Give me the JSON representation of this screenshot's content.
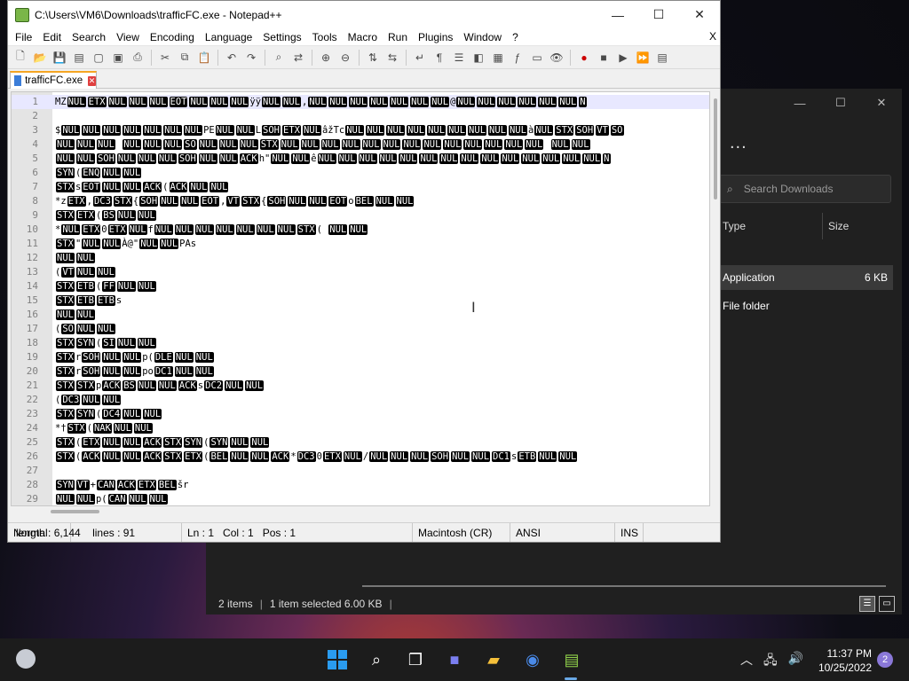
{
  "explorer": {
    "more_label": "...",
    "search_placeholder": "Search Downloads",
    "columns": {
      "type": "Type",
      "size": "Size"
    },
    "rows": [
      {
        "type": "Application",
        "size": "6 KB"
      },
      {
        "type": "File folder",
        "size": ""
      }
    ],
    "status": {
      "items": "2 items",
      "selected": "1 item selected  6.00 KB"
    }
  },
  "npp": {
    "title": "C:\\Users\\VM6\\Downloads\\trafficFC.exe - Notepad++",
    "menus": [
      "File",
      "Edit",
      "Search",
      "View",
      "Encoding",
      "Language",
      "Settings",
      "Tools",
      "Macro",
      "Run",
      "Plugins",
      "Window",
      "?"
    ],
    "close_doc": "X",
    "tab_name": "trafficFC.exe",
    "lines": [
      {
        "n": "1",
        "html": "MZ<b>NUL</b><b>ETX</b><b>NUL</b><b>NUL</b><b>NUL</b><b>EOT</b><b>NUL</b><b>NUL</b><b>NUL</b>ÿÿ<b>NUL</b><b>NUL</b>,<b>NUL</b><b>NUL</b><b>NUL</b><b>NUL</b><b>NUL</b><b>NUL</b><b>NUL</b>@<b>NUL</b><b>NUL</b><b>NUL</b><b>NUL</b><b>NUL</b><b>NUL</b><b>N</b>"
      },
      {
        "n": "2",
        "html": ""
      },
      {
        "n": "3",
        "html": "$<b>NUL</b><b>NUL</b><b>NUL</b><b>NUL</b><b>NUL</b><b>NUL</b><b>NUL</b>PE<b>NUL</b><b>NUL</b>L<b>SOH</b><b>ETX</b><b>NUL</b>âžTc<b>NUL</b><b>NUL</b><b>NUL</b><b>NUL</b><b>NUL</b><b>NUL</b><b>NUL</b><b>NUL</b><b>NUL</b>à<b>NUL</b><b>STX</b><b>SOH</b><b>VT</b><b>SO</b>"
      },
      {
        "n": "4",
        "html": "<b>NUL</b><b>NUL</b><b>NUL</b> <b>NUL</b><b>NUL</b><b>NUL</b><b>SO</b><b>NUL</b><b>NUL</b><b>NUL</b><b>STX</b><b>NUL</b><b>NUL</b><b>NUL</b><b>NUL</b><b>NUL</b><b>NUL</b><b>NUL</b><b>NUL</b><b>NUL</b><b>NUL</b><b>NUL</b><b>NUL</b><b>NUL</b> <b>NUL</b><b>NUL</b>"
      },
      {
        "n": "5",
        "html": "<b>NUL</b><b>NUL</b><b>SOH</b><b>NUL</b><b>NUL</b><b>NUL</b><b>SOH</b><b>NUL</b><b>NUL</b><b>ACK</b>h\"<b>NUL</b><b>NUL</b>ê<b>NUL</b><b>NUL</b><b>NUL</b><b>NUL</b><b>NUL</b><b>NUL</b><b>NUL</b><b>NUL</b><b>NUL</b><b>NUL</b><b>NUL</b><b>NUL</b><b>NUL</b><b>NUL</b><b>N</b>"
      },
      {
        "n": "6",
        "html": "<b>SYN</b>(<b>ENQ</b><b>NUL</b><b>NUL</b>"
      },
      {
        "n": "7",
        "html": "<b>STX</b>s<b>EOT</b><b>NUL</b><b>NUL</b><b>ACK</b>(<b>ACK</b><b>NUL</b><b>NUL</b>"
      },
      {
        "n": "8",
        "html": "*z<b>ETX</b>,<b>DC3</b><b>STX</b>{<b>SOH</b><b>NUL</b><b>NUL</b><b>EOT</b>,<b>VT</b><b>STX</b>{<b>SOH</b><b>NUL</b><b>NUL</b><b>EOT</b>o<b>BEL</b><b>NUL</b><b>NUL</b>"
      },
      {
        "n": "9",
        "html": "<b>STX</b><b>ETX</b>(<b>BS</b><b>NUL</b><b>NUL</b>"
      },
      {
        "n": "10",
        "html": "*<b>NUL</b><b>ETX</b>0<b>ETX</b><b>NUL</b>f<b>NUL</b><b>NUL</b><b>NUL</b><b>NUL</b><b>NUL</b><b>NUL</b><b>NUL</b><b>STX</b>(    <b>NUL</b><b>NUL</b>"
      },
      {
        "n": "11",
        "html": "<b>STX</b>\"<b>NUL</b><b>NUL</b>À@\"<b>NUL</b><b>NUL</b>PAs"
      },
      {
        "n": "12",
        "html": "<b>NUL</b><b>NUL</b>"
      },
      {
        "n": "13",
        "html": "(<b>VT</b><b>NUL</b><b>NUL</b>"
      },
      {
        "n": "14",
        "html": "<b>STX</b><b>ETB</b>(<b>FF</b><b>NUL</b><b>NUL</b>"
      },
      {
        "n": "15",
        "html": "<b>STX</b><b>ETB</b><b>ETB</b>s"
      },
      {
        "n": "16",
        "html": "<b>NUL</b><b>NUL</b>"
      },
      {
        "n": "17",
        "html": "(<b>SO</b><b>NUL</b><b>NUL</b>"
      },
      {
        "n": "18",
        "html": "<b>STX</b><b>SYN</b>(<b>SI</b><b>NUL</b><b>NUL</b>"
      },
      {
        "n": "19",
        "html": "<b>STX</b>r<b>SOH</b><b>NUL</b><b>NUL</b>p(<b>DLE</b><b>NUL</b><b>NUL</b>"
      },
      {
        "n": "20",
        "html": "<b>STX</b>r<b>SOH</b><b>NUL</b><b>NUL</b>po<b>DC1</b><b>NUL</b><b>NUL</b>"
      },
      {
        "n": "21",
        "html": "<b>STX</b><b>STX</b>p<b>ACK</b><b>BS</b><b>NUL</b><b>NUL</b><b>ACK</b>s<b>DC2</b><b>NUL</b><b>NUL</b>"
      },
      {
        "n": "22",
        "html": "(<b>DC3</b><b>NUL</b><b>NUL</b>"
      },
      {
        "n": "23",
        "html": "<b>STX</b><b>SYN</b>(<b>DC4</b><b>NUL</b><b>NUL</b>"
      },
      {
        "n": "24",
        "html": "*†<b>STX</b>(<b>NAK</b><b>NUL</b><b>NUL</b>"
      },
      {
        "n": "25",
        "html": "<b>STX</b>(<b>ETX</b><b>NUL</b><b>NUL</b><b>ACK</b><b>STX</b><b>SYN</b>(<b>SYN</b><b>NUL</b><b>NUL</b>"
      },
      {
        "n": "26",
        "html": "<b>STX</b>(<b>ACK</b><b>NUL</b><b>NUL</b><b>ACK</b><b>STX</b><b>ETX</b>(<b>BEL</b><b>NUL</b><b>NUL</b><b>ACK</b>*<b>DC3</b>0<b>ETX</b><b>NUL</b>/<b>NUL</b><b>NUL</b><b>NUL</b><b>SOH</b><b>NUL</b><b>NUL</b><b>DC1</b>s<b>ETB</b><b>NUL</b><b>NUL</b>"
      },
      {
        "n": "27",
        "html": ""
      },
      {
        "n": "28",
        "html": "<b>SYN</b><b>VT</b>+<b>CAN</b><b>ACK</b><b>ETX</b><b>BEL</b>šr"
      },
      {
        "n": "29",
        "html": "<b>NUL</b><b>NUL</b>p(<b>CAN</b><b>NUL</b><b>NUL</b>"
      }
    ],
    "status": {
      "type": "Normal",
      "length": "length : 6,144",
      "lines": "lines : 91",
      "ln": "Ln : 1",
      "col": "Col : 1",
      "pos": "Pos : 1",
      "eol": "Macintosh (CR)",
      "encoding": "ANSI",
      "mode": "INS"
    }
  },
  "taskbar": {
    "time": "11:37 PM",
    "date": "10/25/2022",
    "notifications": "2"
  },
  "colors": {
    "control_char_bg": "#000000",
    "tab_accent": "#f5a623",
    "start_blue": "#2a9cf0"
  }
}
